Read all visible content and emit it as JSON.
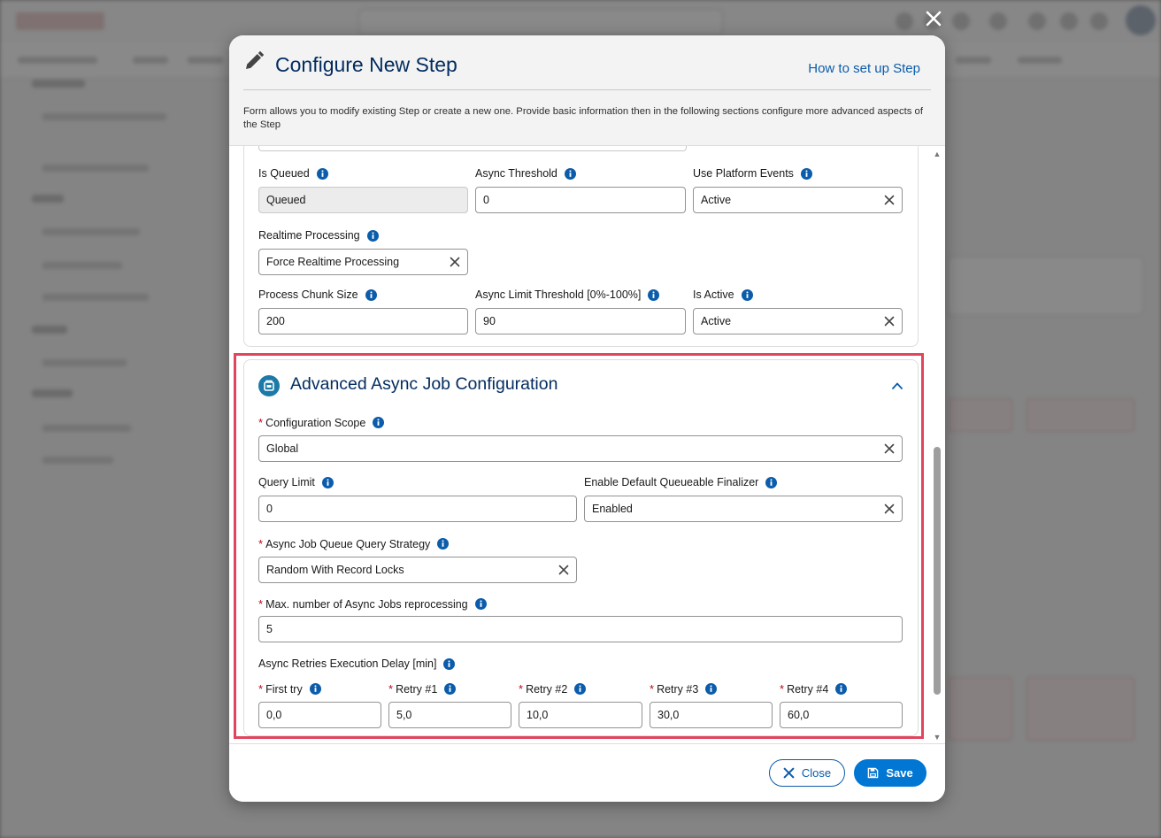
{
  "modal": {
    "title": "Configure New Step",
    "help_link": "How to set up Step",
    "description": "Form allows you to modify existing Step or create a new one. Provide basic information then in the following sections configure more advanced aspects of the Step"
  },
  "processing_section": {
    "is_queued": {
      "label": "Is Queued",
      "value": "Queued"
    },
    "async_threshold": {
      "label": "Async Threshold",
      "value": "0"
    },
    "use_platform_events": {
      "label": "Use Platform Events",
      "value": "Active"
    },
    "realtime_processing": {
      "label": "Realtime Processing",
      "value": "Force Realtime Processing"
    },
    "process_chunk_size": {
      "label": "Process Chunk Size",
      "value": "200"
    },
    "async_limit_threshold": {
      "label": "Async Limit Threshold [0%-100%]",
      "value": "90"
    },
    "is_active": {
      "label": "Is Active",
      "value": "Active"
    }
  },
  "advanced_section": {
    "title": "Advanced Async Job Configuration",
    "configuration_scope": {
      "label": "Configuration Scope",
      "value": "Global",
      "required": "*"
    },
    "query_limit": {
      "label": "Query Limit",
      "value": "0"
    },
    "enable_default_finalizer": {
      "label": "Enable Default Queueable Finalizer",
      "value": "Enabled"
    },
    "queue_query_strategy": {
      "label": "Async Job Queue Query Strategy",
      "value": "Random With Record Locks",
      "required": "*"
    },
    "max_reprocessing": {
      "label": "Max. number of Async Jobs reprocessing",
      "value": "5",
      "required": "*"
    },
    "retries_delay": {
      "label": "Async Retries Execution Delay [min]"
    },
    "retries": [
      {
        "label": "First try",
        "value": "0,0",
        "required": "*"
      },
      {
        "label": "Retry #1",
        "value": "5,0",
        "required": "*"
      },
      {
        "label": "Retry #2",
        "value": "10,0",
        "required": "*"
      },
      {
        "label": "Retry #3",
        "value": "30,0",
        "required": "*"
      },
      {
        "label": "Retry #4",
        "value": "60,0",
        "required": "*"
      }
    ]
  },
  "footer": {
    "close_label": "Close",
    "save_label": "Save"
  },
  "colors": {
    "brand": "#0176d3",
    "title": "#032d60",
    "required": "#ba0517",
    "highlight": "#e0455e"
  }
}
